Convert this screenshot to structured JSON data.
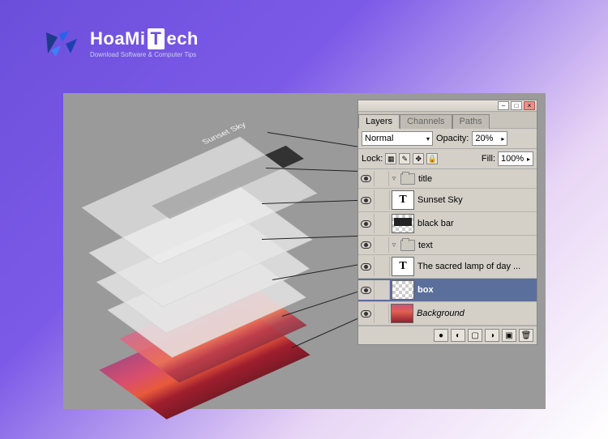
{
  "logo": {
    "name_part1": "HoaMi",
    "name_t": "T",
    "name_part2": "ech",
    "tagline": "Download Software & Computer Tips"
  },
  "iso": {
    "title_text": "Sunset Sky"
  },
  "panel": {
    "tabs": [
      "Layers",
      "Channels",
      "Paths"
    ],
    "blend_mode": "Normal",
    "opacity_label": "Opacity:",
    "opacity_value": "20%",
    "lock_label": "Lock:",
    "fill_label": "Fill:",
    "fill_value": "100%",
    "layers": [
      {
        "type": "group",
        "name": "title"
      },
      {
        "type": "text",
        "name": "Sunset Sky",
        "thumb": "T",
        "indent": 1
      },
      {
        "type": "layer",
        "name": "black bar",
        "thumb": "blackbar",
        "indent": 1
      },
      {
        "type": "group",
        "name": "text"
      },
      {
        "type": "text",
        "name": "The sacred lamp of day  ...",
        "thumb": "T",
        "indent": 1
      },
      {
        "type": "layer",
        "name": "box",
        "thumb": "checker",
        "indent": 1,
        "selected": true,
        "bold": true
      },
      {
        "type": "bg",
        "name": "Background",
        "thumb": "sunset",
        "italic": true
      }
    ]
  }
}
